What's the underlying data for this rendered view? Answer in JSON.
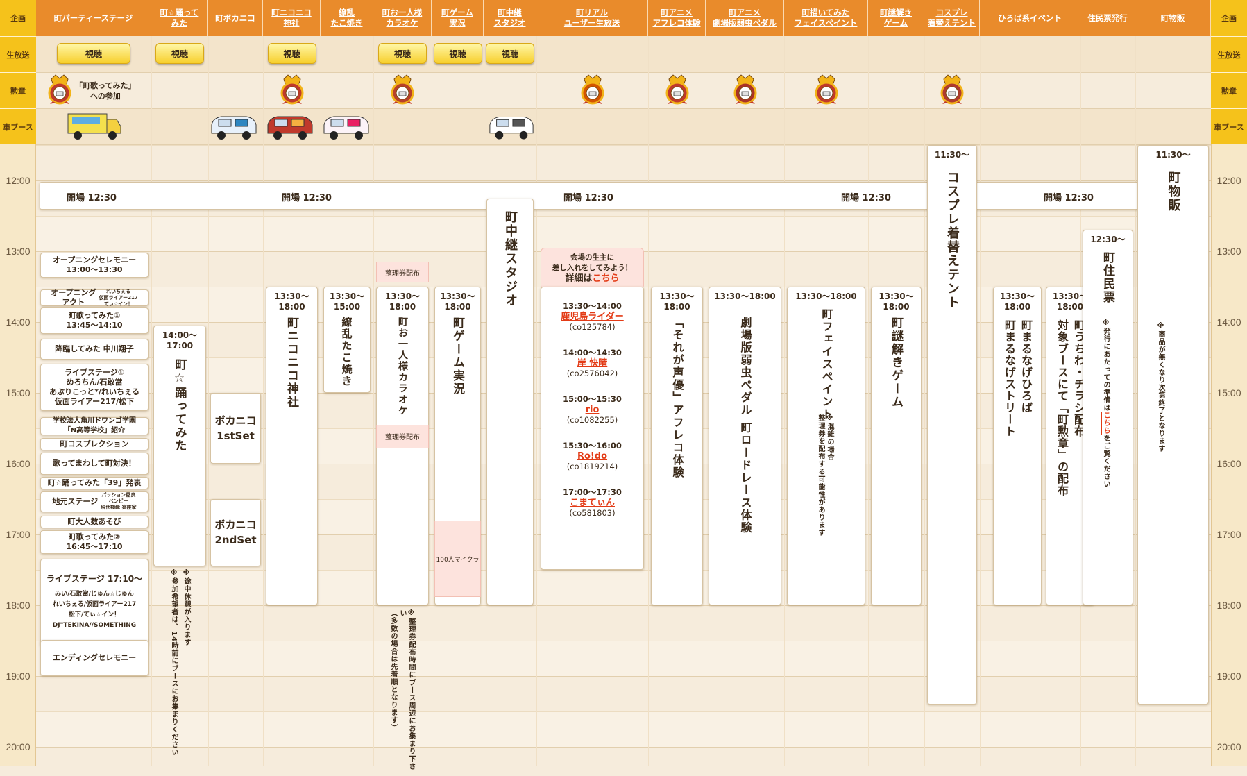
{
  "side_header": "企画",
  "row_labels": {
    "live": "生放送",
    "medal": "勲章",
    "car": "車ブース"
  },
  "columns": [
    "町パーティーステージ",
    "町☆踊って\nみた",
    "町ボカニコ",
    "町ニコニコ\n神社",
    "繚乱\nたこ焼き",
    "町お一人様\nカラオケ",
    "町ゲーム\n実況",
    "町中継\nスタジオ",
    "町リアル\nユーザー生放送",
    "町アニメ\nアフレコ体験",
    "町アニメ\n劇場版弱虫ペダル",
    "町描いてみた\nフェイスペイント",
    "町謎解き\nゲーム",
    "コスプレ\n着替えテント",
    "ひろば系イベント",
    "住民票発行",
    "町物販"
  ],
  "watch_label": "視聴",
  "medal_note": "「町歌ってみた」\nへの参加",
  "times": [
    "12:00",
    "13:00",
    "14:00",
    "15:00",
    "16:00",
    "17:00",
    "18:00",
    "19:00",
    "20:00"
  ],
  "open_label": "開場 12:30",
  "party": [
    "オープニングセレモニー\n13:00〜13:30",
    "オープニング\nアクト",
    "れいちぇる\n仮面ライアー217\nてぃ☆イン！",
    "町歌ってみた①\n13:45〜14:10",
    "降臨してみた 中川翔子",
    "ライブステージ①\nめろちん/石敢當\nあぶりこっと*/れいちぇる\n仮面ライアー217/松下",
    "学校法人角川ドワンゴ学園\n「N高等学校」紹介",
    "町コスプレクション",
    "歌ってまわして町対決！",
    "町☆踊ってみた「39」発表",
    "地元ステージ",
    "パッション屋良\nベンビー\n現代額縁 宴座家",
    "町大人数あそび",
    "町歌ってみた②\n16:45〜17:10",
    "ライブステージ 17:10〜",
    "みい/石敢當/じゅん☆じゅん\nれいちぇる/仮面ライアー217\n松下/てぃ☆イン！\nDJ\"TEKINA//SOMETHING",
    "エンディングセレモニー"
  ],
  "odotte": {
    "time": "14:00〜\n17:00",
    "title": "町☆踊ってみた",
    "note1": "※途中休憩が入ります",
    "note2": "※参加希望者は、14時前にブースにお集まりください"
  },
  "bokaniko": [
    "ボカニコ\n1stSet",
    "ボカニコ\n2ndSet"
  ],
  "jinja": {
    "time": "13:30〜\n18:00",
    "title": "町ニコニコ神社"
  },
  "takoyaki": {
    "time": "13:30〜\n15:00",
    "title": "繚乱たこ焼き"
  },
  "karaoke": {
    "time": "13:30〜\n18:00",
    "title": "町お一人様カラオケ",
    "ticket": "整理券配布",
    "note": "※整理券配布時間にブース周辺にお集まり下さい\n（多数の場合は先着順となります）"
  },
  "game": {
    "time": "13:30〜\n18:00",
    "title": "町ゲーム実況",
    "sub": "100人マイクラ"
  },
  "studio": {
    "title": "町中継スタジオ"
  },
  "real": {
    "promo": "会場の生主に\n差し入れをしてみよう！",
    "promo_link_prefix": "詳細は",
    "promo_link": "こちら",
    "slots": [
      {
        "time": "13:30〜14:00",
        "name": "鹿児島ライダー",
        "id": "(co125784)"
      },
      {
        "time": "14:00〜14:30",
        "name": "岸 快晴",
        "id": "(co2576042)"
      },
      {
        "time": "15:00〜15:30",
        "name": "rio",
        "id": "(co1082255)"
      },
      {
        "time": "15:30〜16:00",
        "name": "Ro!do",
        "id": "(co1819214)"
      },
      {
        "time": "17:00〜17:30",
        "name": "こまてぃん",
        "id": "(co581803)"
      }
    ]
  },
  "afureko": {
    "time": "13:30〜\n18:00",
    "title": "「それが声優」アフレコ体験"
  },
  "pedal": {
    "time": "13:30〜18:00",
    "title": "劇場版弱虫ペダル 町ロードレース体験"
  },
  "face": {
    "time": "13:30〜18:00",
    "title": "町フェイスペイント",
    "note": "※混雑の場合\n整理券を配布する可能性があります"
  },
  "nazo": {
    "time": "13:30〜\n18:00",
    "title": "町謎解きゲーム"
  },
  "cos": {
    "time": "11:30〜",
    "title": "コスプレ着替えテント"
  },
  "hiroba": [
    {
      "time": "13:30〜\n18:00",
      "title": "町まるなげひろば\n町まるなげストリート"
    },
    {
      "time": "13:30〜\n18:00",
      "title": "町うちわ・チラシ配布\n対象ブースにて「町勲章」の配布"
    }
  ],
  "jumin": {
    "time": "12:30〜",
    "title": "町住民票",
    "note_a": "※発行にあたっての準備は",
    "note_link": "こちら",
    "note_b": "をご覧ください"
  },
  "buppan": {
    "time": "11:30〜",
    "title": "町物販",
    "note": "※商品が無くなり次第終了となります"
  },
  "colors": {
    "header": "#e98b2b",
    "side": "#f5c21b",
    "accent_red": "#e33b16",
    "bg": "#f6ecdc"
  }
}
